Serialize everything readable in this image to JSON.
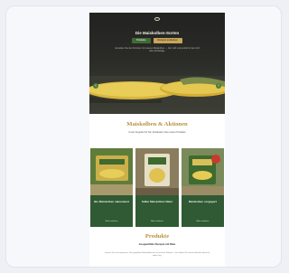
{
  "hero": {
    "logo_text": "Bonduelle",
    "title": "Die Maiskolben-Sorten",
    "button_primary": "Produkte",
    "button_secondary": "Rezepte entdecken",
    "intro": "Genießen Sie den Sommer mit unseren Maiskolben — zart, süß und perfekt für den Grill oder als Beilage."
  },
  "section_products": {
    "title": "Maiskolben & Aktionen",
    "subtitle": "Unser Angebot für Sie: Entdecken Sie unsere Produkte",
    "items": [
      {
        "name": "Bio Maiskolben vakuumiert",
        "cta": "Mehr erfahren"
      },
      {
        "name": "Süßer Maiskolben Natur",
        "cta": "Mehr erfahren"
      },
      {
        "name": "Maiskolben vorgegart",
        "cta": "Mehr erfahren"
      }
    ]
  },
  "section_recipes": {
    "title": "Produkte",
    "subtitle": "Ausgewählte Rezepte mit Mais",
    "text": "Lassen Sie sich inspirieren: Von gegrilltem Maiskolben bis zu frischen Salaten – hier finden Sie unsere liebsten Ideen für jeden Tag.",
    "button": "Mehr"
  },
  "colors": {
    "accent_gold": "#b7923f",
    "brand_green": "#2f5a33",
    "hero_dark": "#222320"
  }
}
